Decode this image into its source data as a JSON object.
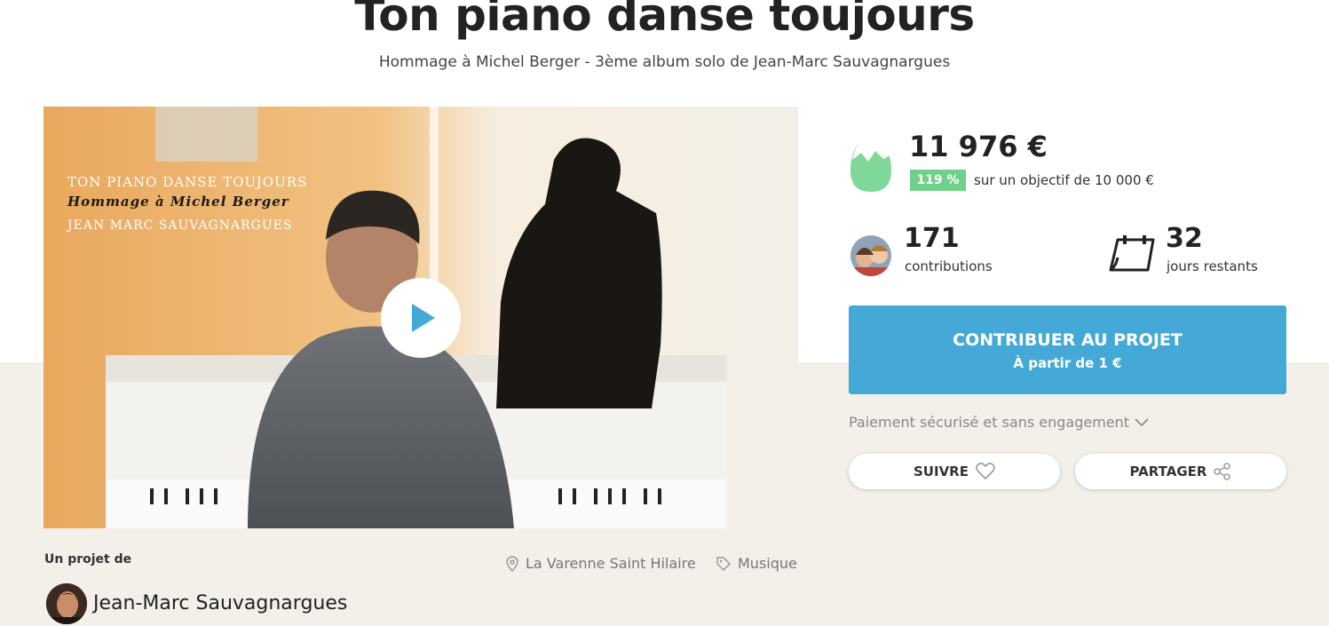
{
  "project": {
    "title": "Ton piano danse toujours",
    "subtitle": "Hommage à Michel Berger - 3ème album solo de Jean-Marc Sauvagnargues"
  },
  "video": {
    "cover_line1": "TON PIANO DANSE TOUJOURS",
    "cover_line2": "Hommage à Michel Berger",
    "cover_line3": "JEAN MARC SAUVAGNARGUES",
    "play_icon": "play-icon"
  },
  "funding": {
    "amount": "11 976 €",
    "percent": "119 %",
    "goal_text": "sur un objectif de 10 000 €",
    "percent_value": 119
  },
  "stats": {
    "contributions_count": "171",
    "contributions_label": "contributions",
    "days_count": "32",
    "days_label": "jours restants"
  },
  "cta": {
    "label": "CONTRIBUER AU PROJET",
    "sub": "À partir de 1 €"
  },
  "payment": {
    "text": "Paiement sécurisé et sans engagement"
  },
  "actions": {
    "follow": "SUIVRE",
    "share": "PARTAGER"
  },
  "owner": {
    "by_label": "Un projet de",
    "name": "Jean-Marc Sauvagnargues",
    "location": "La Varenne Saint Hilaire",
    "category": "Musique"
  },
  "colors": {
    "accent": "#44a9d6",
    "success": "#6fd08c",
    "band": "#f3f0ea"
  }
}
